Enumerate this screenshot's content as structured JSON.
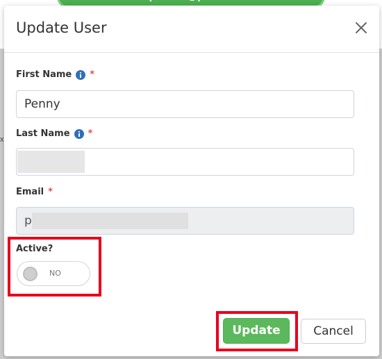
{
  "modal": {
    "title": "Update User",
    "fields": {
      "first_name": {
        "label": "First Name",
        "value": "Penny",
        "required_mark": "*"
      },
      "last_name": {
        "label": "Last Name",
        "value": "",
        "required_mark": "*"
      },
      "email": {
        "label": "Email",
        "value": "p",
        "required_mark": "*"
      },
      "active": {
        "label": "Active?",
        "toggle_text": "NO",
        "is_on": false
      }
    },
    "buttons": {
      "update": "Update",
      "cancel": "Cancel"
    }
  },
  "toast": {
    "text": "p...........@p.........."
  },
  "colors": {
    "accent_green": "#5cb85c",
    "required_red": "#d9534f",
    "highlight_red": "#e8001c",
    "info_blue": "#2f6fb7"
  },
  "icons": {
    "info": "info-icon",
    "close": "close-icon"
  }
}
